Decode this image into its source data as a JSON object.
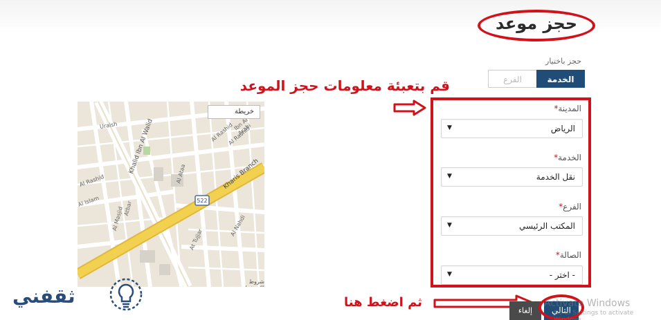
{
  "page_title": "حجز موعد",
  "booking_mode": {
    "label": "حجز باختيار",
    "options": [
      "الفرع",
      "الخدمة"
    ],
    "selected": "الخدمة"
  },
  "annotations": {
    "fill_info": "قم بتعبئة معلومات حجز الموعد",
    "click_here": "ثم اضغط هنا"
  },
  "form": {
    "city": {
      "label": "المدينة",
      "value": "الرياض"
    },
    "service": {
      "label": "الخدمة",
      "value": "نقل الخدمة"
    },
    "branch": {
      "label": "الفرع",
      "value": "المكتب الرئيسي"
    },
    "hall": {
      "label": "الصالة",
      "value": "- اختر -"
    },
    "required_marker": "*"
  },
  "map": {
    "type_button": "خريطة",
    "terms": "شروط الاستخدام",
    "road_badge": "522",
    "labels": [
      "Uraish",
      "Khalid Ibn Al Walid",
      "Al Rashid",
      "Al Islam",
      "Al Rashid",
      "Al Rashid",
      "Kharis Branch",
      "Al Nahdi",
      "At Tujjar",
      "Al Masjid",
      "Ibn Al Arabi",
      "Al Ataa",
      "Atbar"
    ]
  },
  "buttons": {
    "cancel": "إلغاء",
    "next": "التالي"
  },
  "watermark": {
    "line1": "Activate Windows",
    "line2": "Go to Settings to activate Windows."
  },
  "logo": {
    "text": "ثقفني"
  },
  "colors": {
    "accent_red": "#d0121b",
    "primary_blue": "#1f4d77",
    "cancel_gray": "#4a4a4a",
    "road_yellow": "#f3d150"
  },
  "icons": [
    "arrow-right-icon",
    "chevron-down-icon",
    "lightbulb-icon"
  ]
}
